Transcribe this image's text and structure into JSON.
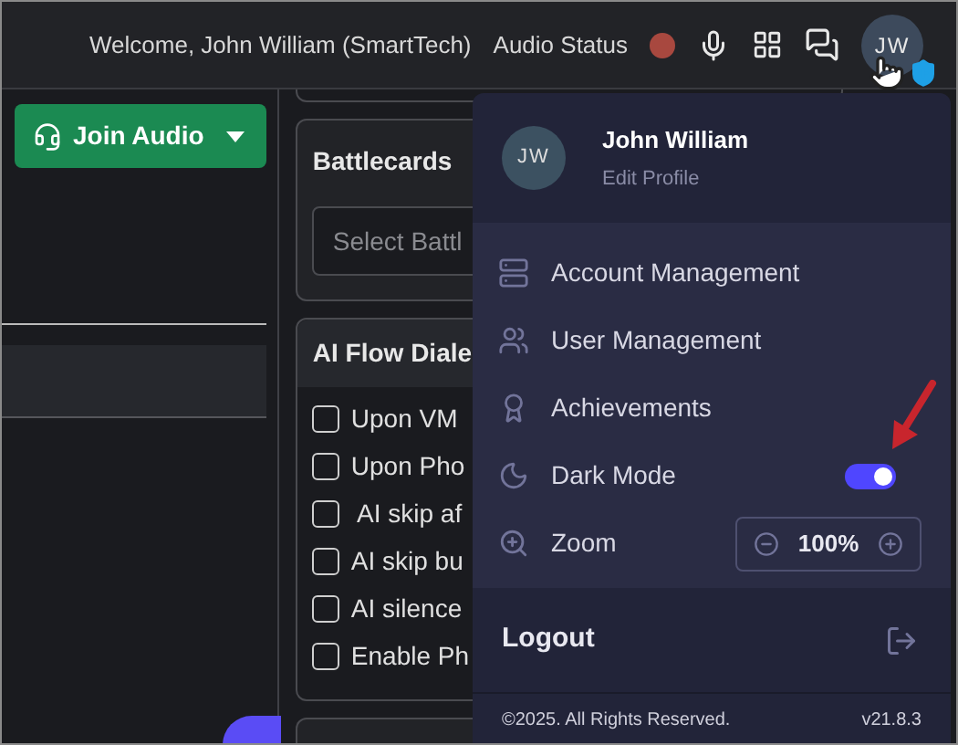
{
  "header": {
    "welcome": "Welcome, John William (SmartTech)",
    "audio_status": "Audio Status",
    "audio_connected": false,
    "avatar": "JW"
  },
  "join_audio": {
    "label": "Join Audio"
  },
  "battlecards": {
    "title": "Battlecards",
    "placeholder": "Select Battl"
  },
  "ai_flow": {
    "title": "AI Flow Diale",
    "options": [
      {
        "label": "Upon VM",
        "checked": false
      },
      {
        "label": "Upon Pho",
        "checked": false
      },
      {
        "label": " AI skip af",
        "checked": false
      },
      {
        "label": "AI skip bu",
        "checked": false
      },
      {
        "label": "AI silence",
        "checked": false
      },
      {
        "label": "Enable Ph",
        "checked": false
      }
    ]
  },
  "menu": {
    "avatar": "JW",
    "name": "John William",
    "edit": "Edit Profile",
    "items": [
      {
        "kind": "link",
        "label": "Account Management"
      },
      {
        "kind": "link",
        "label": "User Management"
      },
      {
        "kind": "link",
        "label": "Achievements"
      },
      {
        "kind": "toggle",
        "label": "Dark Mode",
        "on": true
      },
      {
        "kind": "zoom",
        "label": "Zoom",
        "value": "100%"
      }
    ],
    "logout": "Logout",
    "copyright": "©2025. All Rights Reserved.",
    "version": "v21.8.3"
  }
}
